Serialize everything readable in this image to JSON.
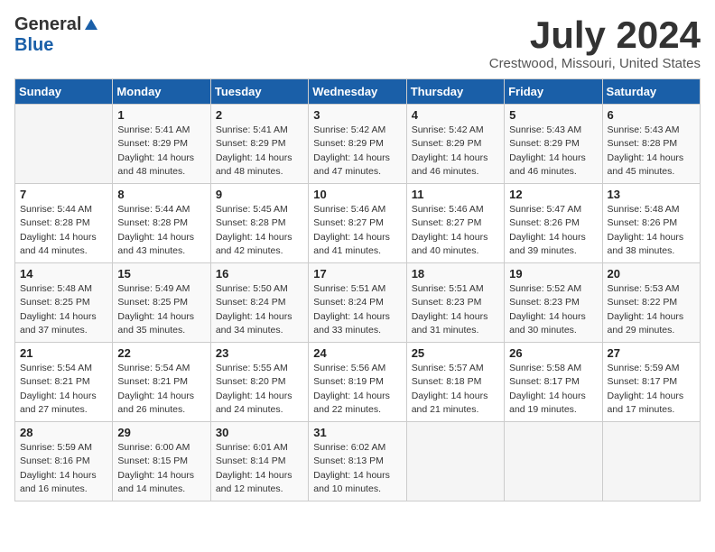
{
  "logo": {
    "general": "General",
    "blue": "Blue"
  },
  "title": "July 2024",
  "subtitle": "Crestwood, Missouri, United States",
  "days_of_week": [
    "Sunday",
    "Monday",
    "Tuesday",
    "Wednesday",
    "Thursday",
    "Friday",
    "Saturday"
  ],
  "weeks": [
    [
      {
        "day": "",
        "info": ""
      },
      {
        "day": "1",
        "info": "Sunrise: 5:41 AM\nSunset: 8:29 PM\nDaylight: 14 hours\nand 48 minutes."
      },
      {
        "day": "2",
        "info": "Sunrise: 5:41 AM\nSunset: 8:29 PM\nDaylight: 14 hours\nand 48 minutes."
      },
      {
        "day": "3",
        "info": "Sunrise: 5:42 AM\nSunset: 8:29 PM\nDaylight: 14 hours\nand 47 minutes."
      },
      {
        "day": "4",
        "info": "Sunrise: 5:42 AM\nSunset: 8:29 PM\nDaylight: 14 hours\nand 46 minutes."
      },
      {
        "day": "5",
        "info": "Sunrise: 5:43 AM\nSunset: 8:29 PM\nDaylight: 14 hours\nand 46 minutes."
      },
      {
        "day": "6",
        "info": "Sunrise: 5:43 AM\nSunset: 8:28 PM\nDaylight: 14 hours\nand 45 minutes."
      }
    ],
    [
      {
        "day": "7",
        "info": "Sunrise: 5:44 AM\nSunset: 8:28 PM\nDaylight: 14 hours\nand 44 minutes."
      },
      {
        "day": "8",
        "info": "Sunrise: 5:44 AM\nSunset: 8:28 PM\nDaylight: 14 hours\nand 43 minutes."
      },
      {
        "day": "9",
        "info": "Sunrise: 5:45 AM\nSunset: 8:28 PM\nDaylight: 14 hours\nand 42 minutes."
      },
      {
        "day": "10",
        "info": "Sunrise: 5:46 AM\nSunset: 8:27 PM\nDaylight: 14 hours\nand 41 minutes."
      },
      {
        "day": "11",
        "info": "Sunrise: 5:46 AM\nSunset: 8:27 PM\nDaylight: 14 hours\nand 40 minutes."
      },
      {
        "day": "12",
        "info": "Sunrise: 5:47 AM\nSunset: 8:26 PM\nDaylight: 14 hours\nand 39 minutes."
      },
      {
        "day": "13",
        "info": "Sunrise: 5:48 AM\nSunset: 8:26 PM\nDaylight: 14 hours\nand 38 minutes."
      }
    ],
    [
      {
        "day": "14",
        "info": "Sunrise: 5:48 AM\nSunset: 8:25 PM\nDaylight: 14 hours\nand 37 minutes."
      },
      {
        "day": "15",
        "info": "Sunrise: 5:49 AM\nSunset: 8:25 PM\nDaylight: 14 hours\nand 35 minutes."
      },
      {
        "day": "16",
        "info": "Sunrise: 5:50 AM\nSunset: 8:24 PM\nDaylight: 14 hours\nand 34 minutes."
      },
      {
        "day": "17",
        "info": "Sunrise: 5:51 AM\nSunset: 8:24 PM\nDaylight: 14 hours\nand 33 minutes."
      },
      {
        "day": "18",
        "info": "Sunrise: 5:51 AM\nSunset: 8:23 PM\nDaylight: 14 hours\nand 31 minutes."
      },
      {
        "day": "19",
        "info": "Sunrise: 5:52 AM\nSunset: 8:23 PM\nDaylight: 14 hours\nand 30 minutes."
      },
      {
        "day": "20",
        "info": "Sunrise: 5:53 AM\nSunset: 8:22 PM\nDaylight: 14 hours\nand 29 minutes."
      }
    ],
    [
      {
        "day": "21",
        "info": "Sunrise: 5:54 AM\nSunset: 8:21 PM\nDaylight: 14 hours\nand 27 minutes."
      },
      {
        "day": "22",
        "info": "Sunrise: 5:54 AM\nSunset: 8:21 PM\nDaylight: 14 hours\nand 26 minutes."
      },
      {
        "day": "23",
        "info": "Sunrise: 5:55 AM\nSunset: 8:20 PM\nDaylight: 14 hours\nand 24 minutes."
      },
      {
        "day": "24",
        "info": "Sunrise: 5:56 AM\nSunset: 8:19 PM\nDaylight: 14 hours\nand 22 minutes."
      },
      {
        "day": "25",
        "info": "Sunrise: 5:57 AM\nSunset: 8:18 PM\nDaylight: 14 hours\nand 21 minutes."
      },
      {
        "day": "26",
        "info": "Sunrise: 5:58 AM\nSunset: 8:17 PM\nDaylight: 14 hours\nand 19 minutes."
      },
      {
        "day": "27",
        "info": "Sunrise: 5:59 AM\nSunset: 8:17 PM\nDaylight: 14 hours\nand 17 minutes."
      }
    ],
    [
      {
        "day": "28",
        "info": "Sunrise: 5:59 AM\nSunset: 8:16 PM\nDaylight: 14 hours\nand 16 minutes."
      },
      {
        "day": "29",
        "info": "Sunrise: 6:00 AM\nSunset: 8:15 PM\nDaylight: 14 hours\nand 14 minutes."
      },
      {
        "day": "30",
        "info": "Sunrise: 6:01 AM\nSunset: 8:14 PM\nDaylight: 14 hours\nand 12 minutes."
      },
      {
        "day": "31",
        "info": "Sunrise: 6:02 AM\nSunset: 8:13 PM\nDaylight: 14 hours\nand 10 minutes."
      },
      {
        "day": "",
        "info": ""
      },
      {
        "day": "",
        "info": ""
      },
      {
        "day": "",
        "info": ""
      }
    ]
  ]
}
